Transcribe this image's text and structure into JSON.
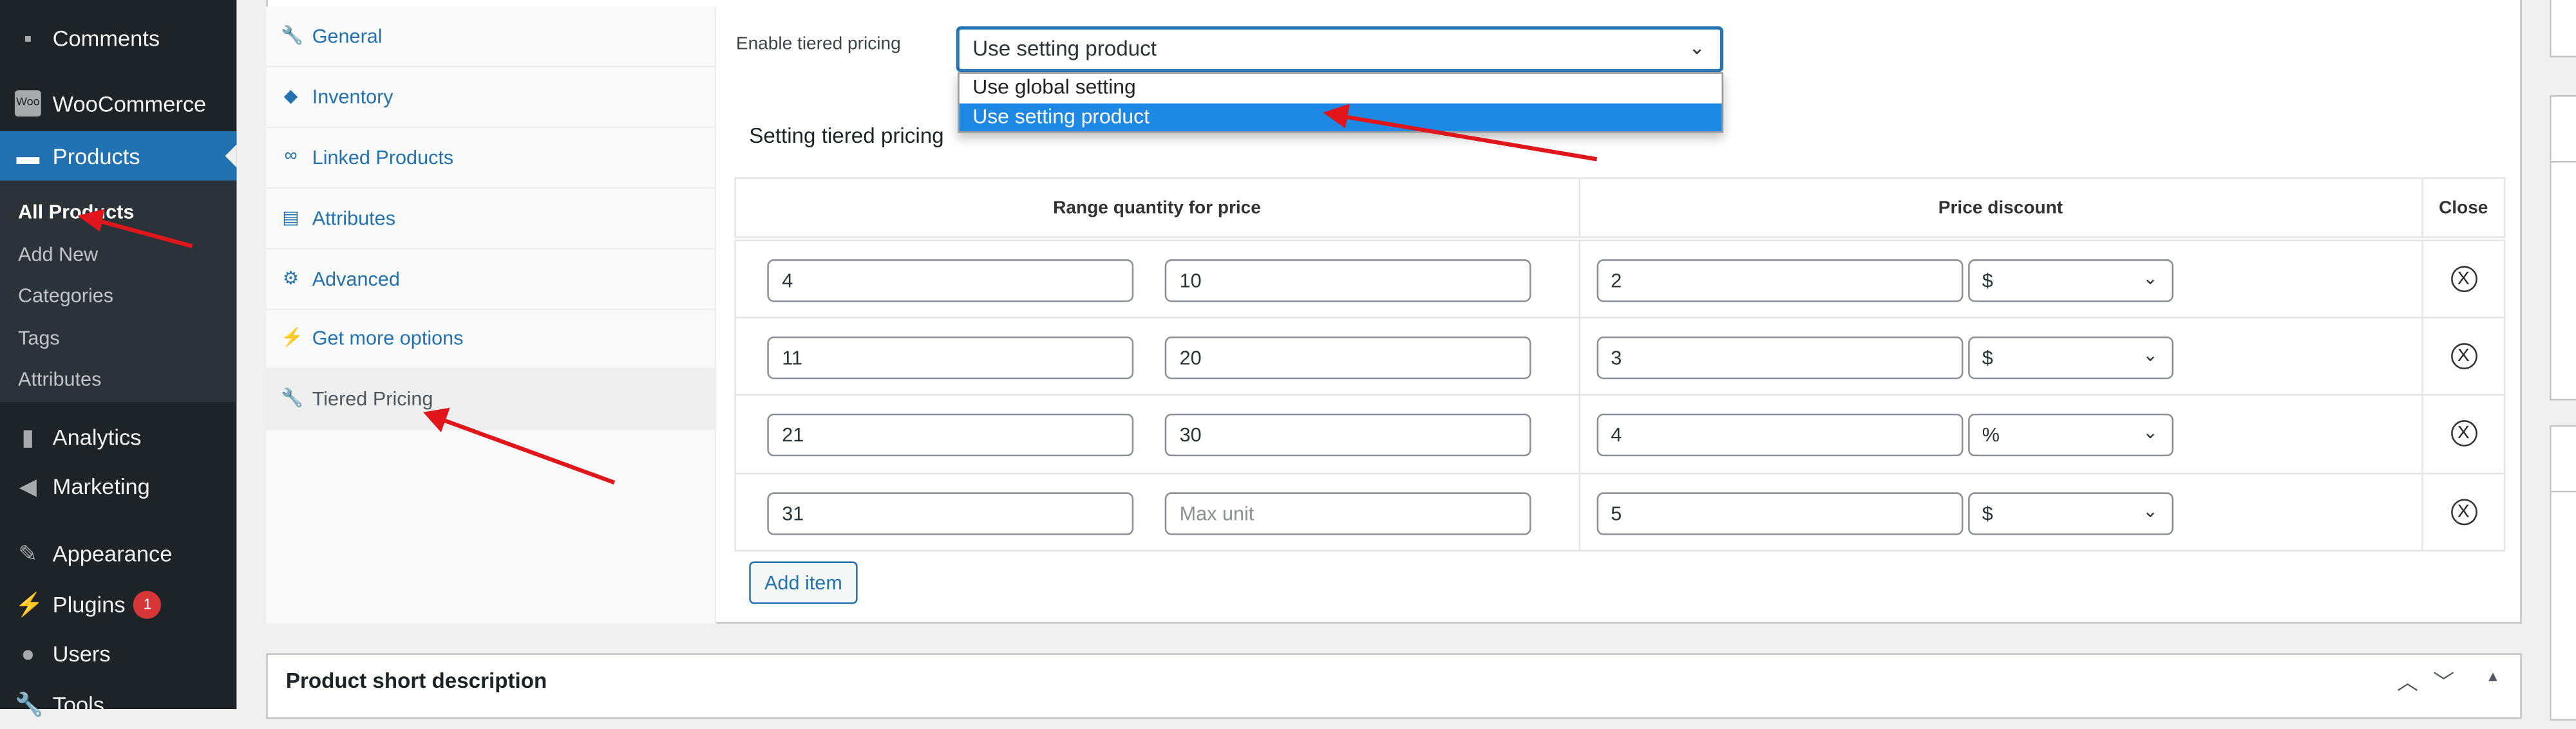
{
  "sidebar": {
    "items": [
      {
        "label": "Comments",
        "icon": "comment-icon"
      },
      {
        "label": "WooCommerce",
        "icon": "woo-icon"
      },
      {
        "label": "Products",
        "icon": "archive-icon"
      },
      {
        "label": "Analytics",
        "icon": "bar-chart-icon"
      },
      {
        "label": "Marketing",
        "icon": "megaphone-icon"
      },
      {
        "label": "Appearance",
        "icon": "paintbrush-icon"
      },
      {
        "label": "Plugins",
        "icon": "plugin-icon",
        "badge": "1"
      },
      {
        "label": "Users",
        "icon": "user-icon"
      },
      {
        "label": "Tools",
        "icon": "wrench-icon"
      }
    ],
    "submenu": [
      "All Products",
      "Add New",
      "Categories",
      "Tags",
      "Attributes"
    ]
  },
  "tabs": [
    {
      "label": "General",
      "icon": "wrench-icon"
    },
    {
      "label": "Inventory",
      "icon": "tag-icon"
    },
    {
      "label": "Linked Products",
      "icon": "link-icon"
    },
    {
      "label": "Attributes",
      "icon": "list-icon"
    },
    {
      "label": "Advanced",
      "icon": "gear-icon"
    },
    {
      "label": "Get more options",
      "icon": "plugin-icon"
    },
    {
      "label": "Tiered Pricing",
      "icon": "wrench-icon"
    }
  ],
  "tiered": {
    "enable_label": "Enable tiered pricing",
    "selected": "Use setting product",
    "options": [
      "Use global setting",
      "Use setting product"
    ],
    "section_title": "Setting tiered pricing",
    "headers": [
      "Range quantity for price",
      "Price discount",
      "Close"
    ],
    "rows": [
      {
        "from": "4",
        "to": "10",
        "discount": "2",
        "unit": "$"
      },
      {
        "from": "11",
        "to": "20",
        "discount": "3",
        "unit": "$"
      },
      {
        "from": "21",
        "to": "30",
        "discount": "4",
        "unit": "%"
      },
      {
        "from": "31",
        "to": "",
        "to_placeholder": "Max unit",
        "discount": "5",
        "unit": "$"
      }
    ],
    "close_symbol": "X",
    "add_item": "Add item"
  },
  "short_description": {
    "title": "Product short description"
  },
  "colors": {
    "accent": "#2271b1",
    "sidebar": "#1d2327",
    "highlight": "#1e88e5",
    "annotation": "#e0161b"
  }
}
